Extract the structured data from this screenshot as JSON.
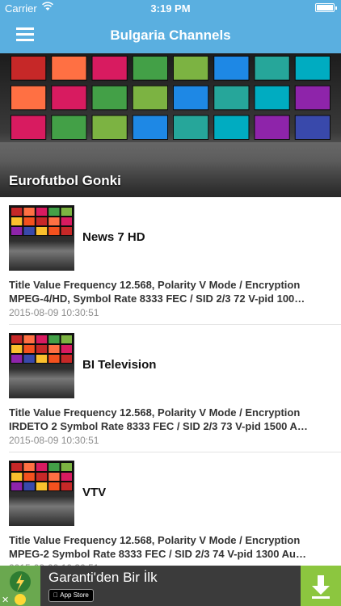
{
  "status": {
    "carrier": "Carrier",
    "time": "3:19 PM"
  },
  "nav": {
    "title": "Bulgaria Channels"
  },
  "featured": {
    "title": "Eurofutbol Gonki"
  },
  "channels": [
    {
      "name": "News 7 HD",
      "line1": "Title Value Frequency 12.568,  Polarity V Mode / Encryption",
      "line2": "MPEG-4/HD, Symbol Rate   8333 FEC / SID 2/3 72 V-pid 100…",
      "date": "2015-08-09 10:30:51"
    },
    {
      "name": "BI Television",
      "line1": "Title Value Frequency 12.568,  Polarity V Mode / Encryption",
      "line2": "IRDETO 2  Symbol Rate   8333 FEC / SID 2/3 73 V-pid 1500 A…",
      "date": "2015-08-09 10:30:51"
    },
    {
      "name": "VTV",
      "line1": "Title Value Frequency 12.568,  Polarity V Mode / Encryption",
      "line2": "MPEG-2  Symbol Rate   8333 FEC / SID 2/3 74 V-pid 1300 Au…",
      "date": "2015-08-09 10:30:51"
    }
  ],
  "ad": {
    "title": "Garanti'den Bir İlk",
    "store": "App Store",
    "close": "✕"
  },
  "colors": {
    "nav": "#5aafe0",
    "ad_bg": "#3b3b3b",
    "ad_download": "#8cc63f"
  },
  "icons": {
    "menu": "hamburger-icon",
    "wifi": "wifi-icon",
    "battery": "battery-icon",
    "download": "download-icon"
  }
}
